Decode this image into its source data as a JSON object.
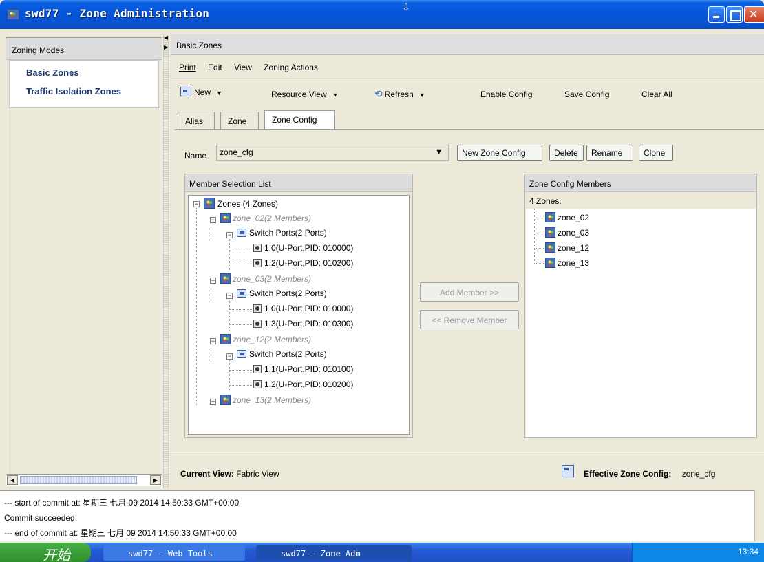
{
  "window": {
    "title": "swd77 - Zone Administration"
  },
  "left": {
    "header": "Zoning Modes",
    "modes": [
      "Basic Zones",
      "Traffic Isolation Zones"
    ]
  },
  "right": {
    "section_title": "Basic Zones",
    "menu": [
      "Print",
      "Edit",
      "View",
      "Zoning Actions"
    ],
    "toolbar": {
      "new": "New",
      "resource_view": "Resource View",
      "refresh": "Refresh",
      "enable_config": "Enable Config",
      "save_config": "Save Config",
      "clear_all": "Clear All"
    },
    "tabs": [
      "Alias",
      "Zone",
      "Zone Config"
    ],
    "name_label": "Name",
    "name_value": "zone_cfg",
    "buttons": {
      "new_zone_config": "New Zone Config",
      "delete": "Delete",
      "rename": "Rename",
      "clone": "Clone",
      "add_member": "Add Member >>",
      "remove_member": "<< Remove Member"
    },
    "member_list": {
      "title": "Member Selection List",
      "root": "Zones (4 Zones)",
      "zones": [
        {
          "name": "zone_02(2 Members)",
          "ports_label": "Switch Ports(2 Ports)",
          "ports": [
            "1,0(U-Port,PID: 010000)",
            "1,2(U-Port,PID: 010200)"
          ]
        },
        {
          "name": "zone_03(2 Members)",
          "ports_label": "Switch Ports(2 Ports)",
          "ports": [
            "1,0(U-Port,PID: 010000)",
            "1,3(U-Port,PID: 010300)"
          ]
        },
        {
          "name": "zone_12(2 Members)",
          "ports_label": "Switch Ports(2 Ports)",
          "ports": [
            "1,1(U-Port,PID: 010100)",
            "1,2(U-Port,PID: 010200)"
          ]
        },
        {
          "name": "zone_13(2 Members)"
        }
      ]
    },
    "config_members": {
      "title": "Zone Config Members",
      "count": "4 Zones.",
      "items": [
        "zone_02",
        "zone_03",
        "zone_12",
        "zone_13"
      ]
    },
    "status": {
      "current_view_label": "Current View:",
      "current_view_value": "Fabric View",
      "effective_label": "Effective Zone Config:",
      "effective_value": "zone_cfg"
    }
  },
  "log": [
    "--- start of commit at: 星期三 七月 09 2014 14:50:33 GMT+00:00",
    "Commit succeeded.",
    "--- end of commit at: 星期三 七月 09 2014 14:50:33 GMT+00:00"
  ],
  "taskbar": {
    "start": "开始",
    "tasks": [
      "swd77 - Web Tools",
      "swd77 - Zone Adm"
    ],
    "clock": "13:34"
  }
}
